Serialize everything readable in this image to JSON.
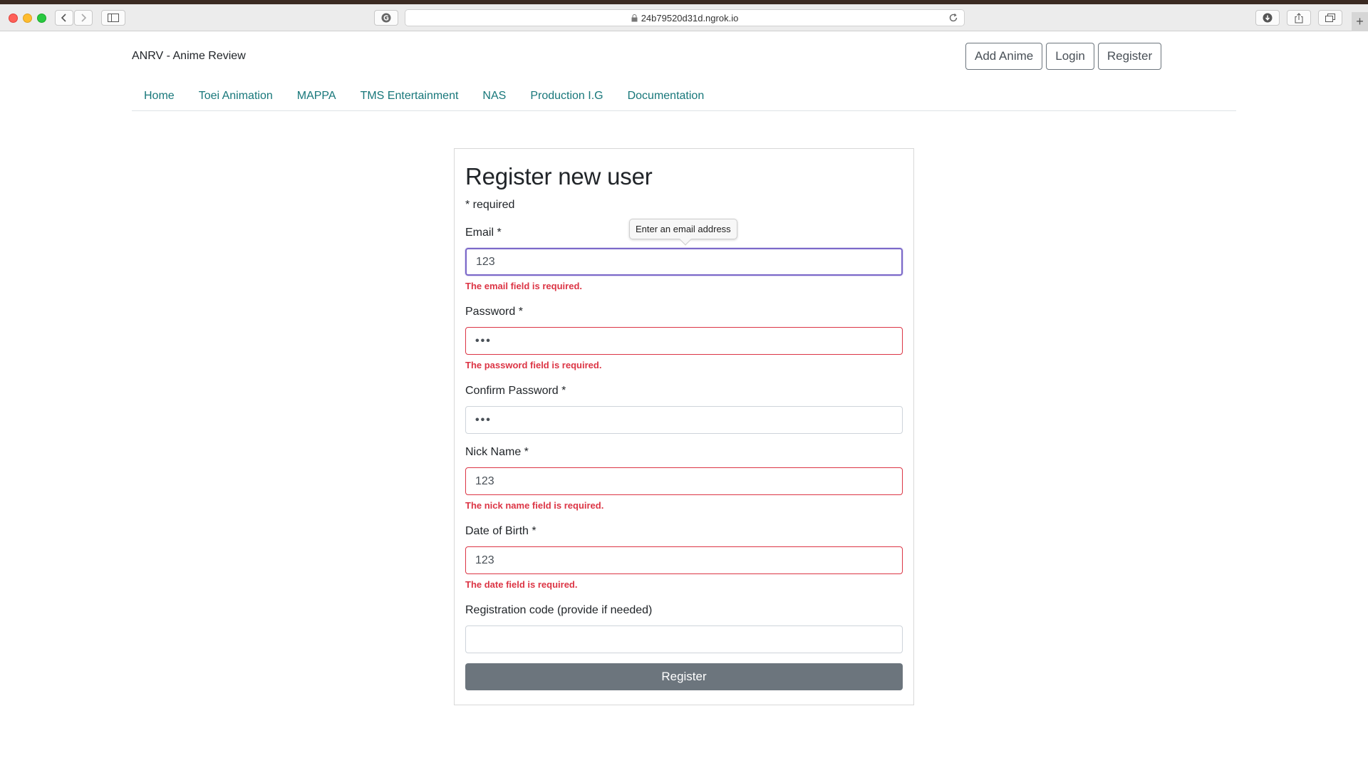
{
  "browser": {
    "url": "24b79520d31d.ngrok.io",
    "new_tab": "+"
  },
  "header": {
    "brand": "ANRV - Anime Review",
    "buttons": {
      "add_anime": "Add Anime",
      "login": "Login",
      "register": "Register"
    }
  },
  "nav": {
    "items": [
      "Home",
      "Toei Animation",
      "MAPPA",
      "TMS Entertainment",
      "NAS",
      "Production I.G",
      "Documentation"
    ]
  },
  "form": {
    "title": "Register new user",
    "required_note": "* required",
    "email": {
      "label": "Email *",
      "value": "123",
      "error": "The email field is required.",
      "tooltip": "Enter an email address"
    },
    "password": {
      "label": "Password *",
      "value": "•••",
      "error": "The password field is required."
    },
    "confirm_password": {
      "label": "Confirm Password *",
      "value": "•••"
    },
    "nick_name": {
      "label": "Nick Name *",
      "value": "123",
      "error": "The nick name field is required."
    },
    "date_of_birth": {
      "label": "Date of Birth *",
      "value": "123",
      "error": "The date field is required."
    },
    "registration_code": {
      "label": "Registration code (provide if needed)",
      "value": ""
    },
    "submit_label": "Register"
  },
  "colors": {
    "link": "#17777a",
    "error": "#dc3545",
    "focus_border": "#7b68c9",
    "submit_bg": "#6c757d"
  }
}
